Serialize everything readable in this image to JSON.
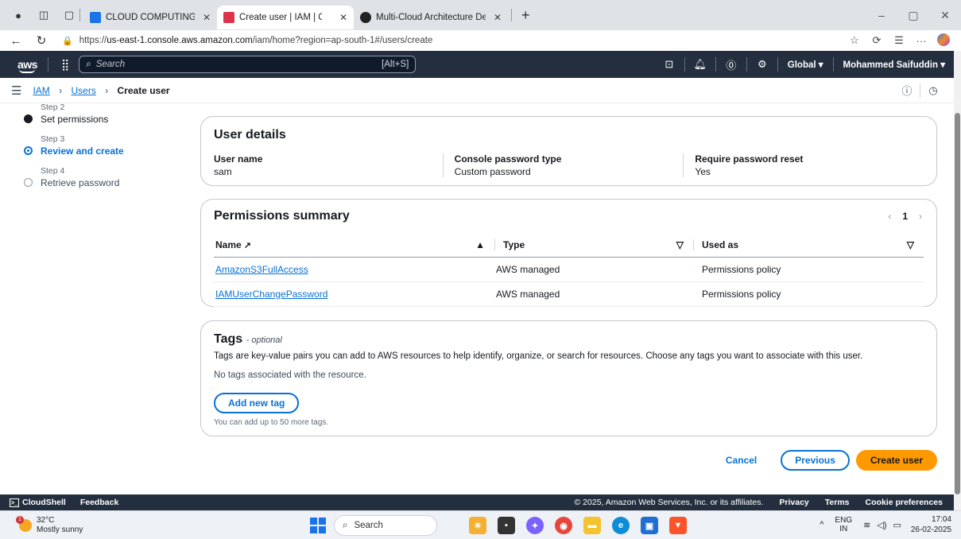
{
  "browser": {
    "tabs": [
      {
        "label": "CLOUD COMPUTING.pdf - Googl",
        "favicon_color": "#1a73e8",
        "active": false
      },
      {
        "label": "Create user | IAM | Global",
        "favicon_color": "#dd344c",
        "active": true
      },
      {
        "label": "Multi-Cloud Architecture Design",
        "favicon_color": "#222222",
        "active": false
      }
    ],
    "url_prefix": "https://",
    "url_host": "us-east-1.console.aws.amazon.com",
    "url_path": "/iam/home?region=ap-south-1#/users/create"
  },
  "aws_nav": {
    "logo": "aws",
    "search_placeholder": "Search",
    "search_shortcut": "[Alt+S]",
    "region": "Global ▾",
    "account": "Mohammed Saifuddin ▾"
  },
  "breadcrumb": {
    "items": [
      "IAM",
      "Users"
    ],
    "current": "Create user"
  },
  "steps": [
    {
      "number": "Step 2",
      "title": "Set permissions",
      "state": "done"
    },
    {
      "number": "Step 3",
      "title": "Review and create",
      "state": "current"
    },
    {
      "number": "Step 4",
      "title": "Retrieve password",
      "state": "todo"
    }
  ],
  "user_details": {
    "title": "User details",
    "fields": [
      {
        "label": "User name",
        "value": "sam"
      },
      {
        "label": "Console password type",
        "value": "Custom password"
      },
      {
        "label": "Require password reset",
        "value": "Yes"
      }
    ]
  },
  "permissions": {
    "title": "Permissions summary",
    "page": "1",
    "columns": [
      "Name",
      "Type",
      "Used as"
    ],
    "rows": [
      {
        "name": "AmazonS3FullAccess",
        "type": "AWS managed",
        "used_as": "Permissions policy"
      },
      {
        "name": "IAMUserChangePassword",
        "type": "AWS managed",
        "used_as": "Permissions policy"
      }
    ]
  },
  "tags": {
    "title": "Tags",
    "optional": "- optional",
    "description": "Tags are key-value pairs you can add to AWS resources to help identify, organize, or search for resources. Choose any tags you want to associate with this user.",
    "empty": "No tags associated with the resource.",
    "add_button": "Add new tag",
    "hint": "You can add up to 50 more tags."
  },
  "actions": {
    "cancel": "Cancel",
    "previous": "Previous",
    "create": "Create user"
  },
  "footer": {
    "cloudshell": "CloudShell",
    "feedback": "Feedback",
    "copyright": "© 2025, Amazon Web Services, Inc. or its affiliates.",
    "privacy": "Privacy",
    "terms": "Terms",
    "cookies": "Cookie preferences"
  },
  "taskbar": {
    "weather_badge": "1",
    "temperature": "32°C",
    "weather_text": "Mostly sunny",
    "search": "Search",
    "lang_top": "ENG",
    "lang_bottom": "IN",
    "time": "17:04",
    "date": "26-02-2025"
  }
}
